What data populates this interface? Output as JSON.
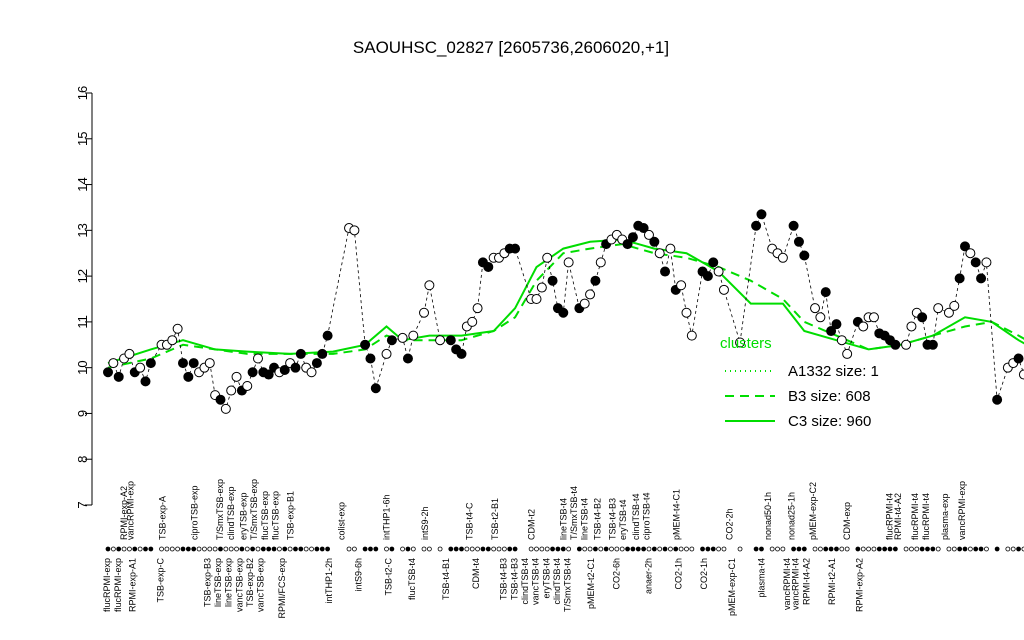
{
  "chart_data": {
    "type": "line",
    "title": "SAOUHSC_02827 [2605736,2606020,+1]",
    "ylim": [
      7,
      16
    ],
    "yticks": [
      7,
      8,
      9,
      10,
      11,
      12,
      13,
      14,
      15,
      16
    ],
    "xlim": [
      0,
      160
    ],
    "line_color": "#00dd00",
    "x_labels_top": [
      {
        "x": 4.5,
        "label": "RPMI-exp-A2"
      },
      {
        "x": 6,
        "label": "vancRPMI-exp"
      },
      {
        "x": 13.5,
        "label": "TSB-exp-A"
      },
      {
        "x": 21,
        "label": "ciproTSB-exp"
      },
      {
        "x": 27,
        "label": "T/SmxTSB-exp"
      },
      {
        "x": 29.5,
        "label": "clindTSB-exp"
      },
      {
        "x": 32.5,
        "label": "eryTSB-exp"
      },
      {
        "x": 35,
        "label": "T/SmxTSB-exp"
      },
      {
        "x": 37.5,
        "label": "flucTSB-exp"
      },
      {
        "x": 40,
        "label": "flucTSB-exp"
      },
      {
        "x": 43.5,
        "label": "TSB-exp-B1"
      },
      {
        "x": 55.5,
        "label": "colist-exp"
      },
      {
        "x": 66,
        "label": "intTHP1-6h"
      },
      {
        "x": 75,
        "label": "intS9-2h"
      },
      {
        "x": 85.5,
        "label": "TSB-t4-C"
      },
      {
        "x": 91.5,
        "label": "TSB-t2-B1"
      },
      {
        "x": 100,
        "label": "CDM-t2"
      },
      {
        "x": 107.5,
        "label": "lineTSB-t4"
      },
      {
        "x": 110,
        "label": "T/SmxTSB-t4"
      },
      {
        "x": 112.5,
        "label": "lineTSB-t4"
      },
      {
        "x": 115.5,
        "label": "TSB-t4-B2"
      },
      {
        "x": 119,
        "label": "TSB-t4-B3"
      },
      {
        "x": 121.5,
        "label": "eryTSB-t4"
      },
      {
        "x": 124.5,
        "label": "clindTSB-t4"
      },
      {
        "x": 127,
        "label": "ciproTSB-t4"
      },
      {
        "x": 134,
        "label": "pMEM-t4-C1"
      },
      {
        "x": 146.5,
        "label": "CO2-2h"
      },
      {
        "x": 155.5,
        "label": "nonad50-1h"
      },
      {
        "x": 161,
        "label": "nonad25-1h"
      },
      {
        "x": 166,
        "label": "pMEM-exp-C2"
      },
      {
        "x": 174,
        "label": "CDM-exp"
      },
      {
        "x": 184,
        "label": "flucRPMI-t4"
      },
      {
        "x": 186,
        "label": "RPMI-t4-A2"
      },
      {
        "x": 190,
        "label": "flucRPMI-t4"
      },
      {
        "x": 192.5,
        "label": "flucRPMI-t4"
      },
      {
        "x": 197,
        "label": "plasma-exp"
      },
      {
        "x": 201,
        "label": "vancRPMI-exp"
      }
    ],
    "x_labels_bottom": [
      {
        "x": 0.5,
        "label": "flucRPMI-exp"
      },
      {
        "x": 3,
        "label": "flucRPMI-exp"
      },
      {
        "x": 6.5,
        "label": "RPMI-exp-A1"
      },
      {
        "x": 13,
        "label": "TSB-exp-C"
      },
      {
        "x": 24,
        "label": "TSB-exp-B3"
      },
      {
        "x": 26.5,
        "label": "lineTSB-exp"
      },
      {
        "x": 29,
        "label": "lineTSB-exp"
      },
      {
        "x": 31.5,
        "label": "vancTSB-exp"
      },
      {
        "x": 34,
        "label": "TSB-exp-B2"
      },
      {
        "x": 36.5,
        "label": "vancTSB-exp"
      },
      {
        "x": 41.5,
        "label": "RPMI/FCS-exp"
      },
      {
        "x": 52.5,
        "label": "intTHP1-2h"
      },
      {
        "x": 59.5,
        "label": "intS9-6h"
      },
      {
        "x": 66.5,
        "label": "TSB-t2-C"
      },
      {
        "x": 72,
        "label": "flucTSB-t4"
      },
      {
        "x": 80,
        "label": "TSB-t4-B1"
      },
      {
        "x": 87,
        "label": "CDM-t4"
      },
      {
        "x": 93.5,
        "label": "TSB-t4-B3"
      },
      {
        "x": 96,
        "label": "TSB-t4-B3"
      },
      {
        "x": 98.5,
        "label": "clindTSB-t4"
      },
      {
        "x": 101,
        "label": "vancTSB-t4"
      },
      {
        "x": 103.5,
        "label": "eryTSB-t4"
      },
      {
        "x": 106,
        "label": "clindTSB-t4"
      },
      {
        "x": 108.5,
        "label": "T/SmxTSB-t4"
      },
      {
        "x": 114,
        "label": "pMEM-t2-C1"
      },
      {
        "x": 120,
        "label": "CO2-6h"
      },
      {
        "x": 127.5,
        "label": "anaer-2h"
      },
      {
        "x": 134.5,
        "label": "CO2-1h"
      },
      {
        "x": 140.5,
        "label": "CO2-1h"
      },
      {
        "x": 147,
        "label": "pMEM-exp-C1"
      },
      {
        "x": 154,
        "label": "plasma-t4"
      },
      {
        "x": 160,
        "label": "vancRPMI-t4"
      },
      {
        "x": 162,
        "label": "vancRPMI-t4"
      },
      {
        "x": 164.5,
        "label": "RPMI-t4-A2"
      },
      {
        "x": 170.5,
        "label": "RPMI-t2-A1"
      },
      {
        "x": 177,
        "label": "RPMI-exp-A2"
      }
    ],
    "series": [
      {
        "name": "A1332 size: 1",
        "style": "dotted",
        "values": []
      },
      {
        "name": "B3 size: 608",
        "style": "dashed",
        "points": [
          [
            0,
            10.0
          ],
          [
            8,
            10.2
          ],
          [
            14,
            10.5
          ],
          [
            20,
            10.4
          ],
          [
            26,
            10.3
          ],
          [
            34,
            10.3
          ],
          [
            42,
            10.3
          ],
          [
            48,
            10.4
          ],
          [
            52,
            10.7
          ],
          [
            55,
            10.6
          ],
          [
            60,
            10.6
          ],
          [
            66,
            10.6
          ],
          [
            72,
            10.8
          ],
          [
            76,
            11.1
          ],
          [
            80,
            11.9
          ],
          [
            85,
            12.5
          ],
          [
            90,
            12.6
          ],
          [
            96,
            12.7
          ],
          [
            102,
            12.5
          ],
          [
            108,
            12.4
          ],
          [
            114,
            12.2
          ],
          [
            120,
            11.9
          ],
          [
            126,
            11.5
          ],
          [
            130,
            11.0
          ],
          [
            136,
            10.7
          ],
          [
            142,
            10.4
          ],
          [
            148,
            10.5
          ],
          [
            154,
            10.7
          ],
          [
            160,
            10.9
          ],
          [
            165,
            11.0
          ],
          [
            170,
            10.7
          ],
          [
            176,
            10.3
          ],
          [
            180,
            10.1
          ]
        ]
      },
      {
        "name": "C3 size: 960",
        "style": "solid",
        "points": [
          [
            0,
            10.1
          ],
          [
            8,
            10.4
          ],
          [
            14,
            10.6
          ],
          [
            20,
            10.4
          ],
          [
            26,
            10.35
          ],
          [
            34,
            10.3
          ],
          [
            42,
            10.35
          ],
          [
            48,
            10.5
          ],
          [
            52,
            10.9
          ],
          [
            55,
            10.6
          ],
          [
            60,
            10.7
          ],
          [
            66,
            10.7
          ],
          [
            72,
            10.8
          ],
          [
            76,
            11.3
          ],
          [
            80,
            12.2
          ],
          [
            85,
            12.6
          ],
          [
            90,
            12.75
          ],
          [
            96,
            12.8
          ],
          [
            102,
            12.6
          ],
          [
            108,
            12.5
          ],
          [
            114,
            12.1
          ],
          [
            120,
            11.4
          ],
          [
            126,
            11.4
          ],
          [
            130,
            10.8
          ],
          [
            136,
            10.6
          ],
          [
            142,
            10.4
          ],
          [
            148,
            10.5
          ],
          [
            154,
            10.7
          ],
          [
            160,
            11.1
          ],
          [
            165,
            11.0
          ],
          [
            170,
            10.6
          ],
          [
            176,
            10.2
          ],
          [
            180,
            10.15
          ]
        ]
      }
    ],
    "points": [
      [
        0,
        9.9,
        1
      ],
      [
        1,
        10.1,
        0
      ],
      [
        2,
        9.8,
        1
      ],
      [
        3,
        10.2,
        0
      ],
      [
        4,
        10.3,
        0
      ],
      [
        5,
        9.9,
        1
      ],
      [
        6,
        10.0,
        0
      ],
      [
        7,
        9.7,
        1
      ],
      [
        8,
        10.1,
        1
      ],
      [
        10,
        10.5,
        0
      ],
      [
        11,
        10.5,
        0
      ],
      [
        12,
        10.6,
        0
      ],
      [
        13,
        10.85,
        0
      ],
      [
        14,
        10.1,
        1
      ],
      [
        15,
        9.8,
        1
      ],
      [
        16,
        10.1,
        1
      ],
      [
        17,
        9.9,
        0
      ],
      [
        18,
        10.0,
        0
      ],
      [
        19,
        10.1,
        0
      ],
      [
        20,
        9.4,
        0
      ],
      [
        21,
        9.3,
        1
      ],
      [
        22,
        9.1,
        0
      ],
      [
        23,
        9.5,
        0
      ],
      [
        24,
        9.8,
        0
      ],
      [
        25,
        9.5,
        1
      ],
      [
        26,
        9.6,
        0
      ],
      [
        27,
        9.9,
        1
      ],
      [
        28,
        10.2,
        0
      ],
      [
        29,
        9.9,
        1
      ],
      [
        30,
        9.85,
        1
      ],
      [
        31,
        10.0,
        1
      ],
      [
        32,
        9.9,
        0
      ],
      [
        33,
        9.95,
        1
      ],
      [
        34,
        10.1,
        0
      ],
      [
        35,
        10.0,
        1
      ],
      [
        36,
        10.3,
        1
      ],
      [
        37,
        10.0,
        0
      ],
      [
        38,
        9.9,
        0
      ],
      [
        39,
        10.1,
        1
      ],
      [
        40,
        10.3,
        1
      ],
      [
        41,
        10.7,
        1
      ],
      [
        45,
        13.05,
        0
      ],
      [
        46,
        13.0,
        0
      ],
      [
        48,
        10.5,
        1
      ],
      [
        49,
        10.2,
        1
      ],
      [
        50,
        9.55,
        1
      ],
      [
        52,
        10.3,
        0
      ],
      [
        53,
        10.6,
        1
      ],
      [
        55,
        10.65,
        0
      ],
      [
        56,
        10.2,
        1
      ],
      [
        57,
        10.7,
        0
      ],
      [
        59,
        11.2,
        0
      ],
      [
        60,
        11.8,
        0
      ],
      [
        62,
        10.6,
        0
      ],
      [
        64,
        10.6,
        1
      ],
      [
        65,
        10.4,
        1
      ],
      [
        66,
        10.3,
        1
      ],
      [
        67,
        10.9,
        0
      ],
      [
        68,
        11.0,
        0
      ],
      [
        69,
        11.3,
        0
      ],
      [
        70,
        12.3,
        1
      ],
      [
        71,
        12.2,
        1
      ],
      [
        72,
        12.4,
        0
      ],
      [
        73,
        12.4,
        0
      ],
      [
        74,
        12.5,
        0
      ],
      [
        75,
        12.6,
        1
      ],
      [
        76,
        12.6,
        1
      ],
      [
        79,
        11.5,
        0
      ],
      [
        80,
        11.5,
        0
      ],
      [
        81,
        11.75,
        0
      ],
      [
        82,
        12.4,
        0
      ],
      [
        83,
        11.9,
        1
      ],
      [
        84,
        11.3,
        1
      ],
      [
        85,
        11.2,
        1
      ],
      [
        86,
        12.3,
        0
      ],
      [
        88,
        11.3,
        1
      ],
      [
        89,
        11.4,
        0
      ],
      [
        90,
        11.6,
        0
      ],
      [
        91,
        11.9,
        1
      ],
      [
        92,
        12.3,
        0
      ],
      [
        93,
        12.7,
        1
      ],
      [
        94,
        12.8,
        0
      ],
      [
        95,
        12.9,
        0
      ],
      [
        96,
        12.8,
        0
      ],
      [
        97,
        12.7,
        1
      ],
      [
        98,
        12.85,
        1
      ],
      [
        99,
        13.1,
        1
      ],
      [
        100,
        13.05,
        1
      ],
      [
        101,
        12.9,
        0
      ],
      [
        102,
        12.75,
        1
      ],
      [
        103,
        12.5,
        0
      ],
      [
        104,
        12.1,
        1
      ],
      [
        105,
        12.6,
        0
      ],
      [
        106,
        11.7,
        1
      ],
      [
        107,
        11.8,
        0
      ],
      [
        108,
        11.2,
        0
      ],
      [
        109,
        10.7,
        0
      ],
      [
        111,
        12.1,
        1
      ],
      [
        112,
        12.0,
        1
      ],
      [
        113,
        12.3,
        1
      ],
      [
        114,
        12.1,
        0
      ],
      [
        115,
        11.7,
        0
      ],
      [
        118,
        10.55,
        0
      ],
      [
        121,
        13.1,
        1
      ],
      [
        122,
        13.35,
        1
      ],
      [
        124,
        12.6,
        0
      ],
      [
        125,
        12.5,
        0
      ],
      [
        126,
        12.4,
        0
      ],
      [
        128,
        13.1,
        1
      ],
      [
        129,
        12.75,
        1
      ],
      [
        130,
        12.45,
        1
      ],
      [
        132,
        11.3,
        0
      ],
      [
        133,
        11.1,
        0
      ],
      [
        134,
        11.65,
        1
      ],
      [
        135,
        10.8,
        1
      ],
      [
        136,
        10.95,
        1
      ],
      [
        137,
        10.6,
        0
      ],
      [
        138,
        10.3,
        0
      ],
      [
        140,
        11.0,
        1
      ],
      [
        141,
        10.9,
        0
      ],
      [
        142,
        11.1,
        0
      ],
      [
        143,
        11.1,
        0
      ],
      [
        144,
        10.75,
        1
      ],
      [
        145,
        10.7,
        1
      ],
      [
        146,
        10.6,
        1
      ],
      [
        147,
        10.5,
        1
      ],
      [
        149,
        10.5,
        0
      ],
      [
        150,
        10.9,
        0
      ],
      [
        151,
        11.2,
        0
      ],
      [
        152,
        11.1,
        1
      ],
      [
        153,
        10.5,
        1
      ],
      [
        154,
        10.5,
        1
      ],
      [
        155,
        11.3,
        0
      ],
      [
        157,
        11.2,
        0
      ],
      [
        158,
        11.35,
        0
      ],
      [
        159,
        11.95,
        1
      ],
      [
        160,
        12.65,
        1
      ],
      [
        161,
        12.5,
        0
      ],
      [
        162,
        12.3,
        1
      ],
      [
        163,
        11.95,
        1
      ],
      [
        164,
        12.3,
        0
      ],
      [
        166,
        9.3,
        1
      ],
      [
        168,
        10.0,
        0
      ],
      [
        169,
        10.1,
        0
      ],
      [
        170,
        10.2,
        1
      ],
      [
        171,
        9.85,
        0
      ]
    ],
    "legend": {
      "position": "right",
      "title": "clusters",
      "entries": [
        {
          "label": "A1332 size: 1",
          "style": "dotted"
        },
        {
          "label": "B3 size: 608",
          "style": "dashed"
        },
        {
          "label": "C3 size: 960",
          "style": "solid"
        }
      ]
    }
  }
}
